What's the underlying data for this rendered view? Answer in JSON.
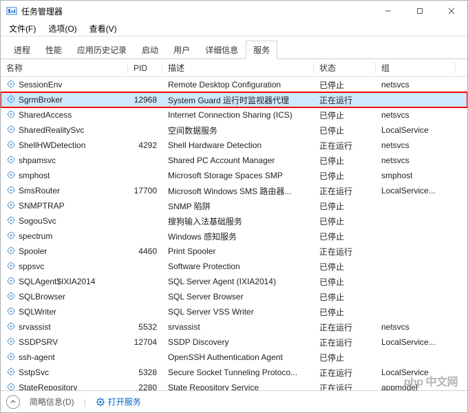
{
  "window": {
    "title": "任务管理器"
  },
  "menu": {
    "file": "文件(F)",
    "options": "选项(O)",
    "view": "查看(V)"
  },
  "tabs": {
    "processes": "进程",
    "performance": "性能",
    "history": "应用历史记录",
    "startup": "启动",
    "users": "用户",
    "details": "详细信息",
    "services": "服务"
  },
  "columns": {
    "name": "名称",
    "pid": "PID",
    "description": "描述",
    "status": "状态",
    "group": "组"
  },
  "services": [
    {
      "name": "SessionEnv",
      "pid": "",
      "desc": "Remote Desktop Configuration",
      "status": "已停止",
      "group": "netsvcs",
      "selected": false
    },
    {
      "name": "SgrmBroker",
      "pid": "12968",
      "desc": "System Guard 运行时监视器代理",
      "status": "正在运行",
      "group": "",
      "selected": true
    },
    {
      "name": "SharedAccess",
      "pid": "",
      "desc": "Internet Connection Sharing (ICS)",
      "status": "已停止",
      "group": "netsvcs",
      "selected": false
    },
    {
      "name": "SharedRealitySvc",
      "pid": "",
      "desc": "空间数据服务",
      "status": "已停止",
      "group": "LocalService",
      "selected": false
    },
    {
      "name": "ShellHWDetection",
      "pid": "4292",
      "desc": "Shell Hardware Detection",
      "status": "正在运行",
      "group": "netsvcs",
      "selected": false
    },
    {
      "name": "shpamsvc",
      "pid": "",
      "desc": "Shared PC Account Manager",
      "status": "已停止",
      "group": "netsvcs",
      "selected": false
    },
    {
      "name": "smphost",
      "pid": "",
      "desc": "Microsoft Storage Spaces SMP",
      "status": "已停止",
      "group": "smphost",
      "selected": false
    },
    {
      "name": "SmsRouter",
      "pid": "17700",
      "desc": "Microsoft Windows SMS 路由器...",
      "status": "正在运行",
      "group": "LocalService...",
      "selected": false
    },
    {
      "name": "SNMPTRAP",
      "pid": "",
      "desc": "SNMP 陷阱",
      "status": "已停止",
      "group": "",
      "selected": false
    },
    {
      "name": "SogouSvc",
      "pid": "",
      "desc": "搜狗输入法基础服务",
      "status": "已停止",
      "group": "",
      "selected": false
    },
    {
      "name": "spectrum",
      "pid": "",
      "desc": "Windows 感知服务",
      "status": "已停止",
      "group": "",
      "selected": false
    },
    {
      "name": "Spooler",
      "pid": "4460",
      "desc": "Print Spooler",
      "status": "正在运行",
      "group": "",
      "selected": false
    },
    {
      "name": "sppsvc",
      "pid": "",
      "desc": "Software Protection",
      "status": "已停止",
      "group": "",
      "selected": false
    },
    {
      "name": "SQLAgent$IXIA2014",
      "pid": "",
      "desc": "SQL Server Agent (IXIA2014)",
      "status": "已停止",
      "group": "",
      "selected": false
    },
    {
      "name": "SQLBrowser",
      "pid": "",
      "desc": "SQL Server Browser",
      "status": "已停止",
      "group": "",
      "selected": false
    },
    {
      "name": "SQLWriter",
      "pid": "",
      "desc": "SQL Server VSS Writer",
      "status": "已停止",
      "group": "",
      "selected": false
    },
    {
      "name": "srvassist",
      "pid": "5532",
      "desc": "srvassist",
      "status": "正在运行",
      "group": "netsvcs",
      "selected": false
    },
    {
      "name": "SSDPSRV",
      "pid": "12704",
      "desc": "SSDP Discovery",
      "status": "正在运行",
      "group": "LocalService...",
      "selected": false
    },
    {
      "name": "ssh-agent",
      "pid": "",
      "desc": "OpenSSH Authentication Agent",
      "status": "已停止",
      "group": "",
      "selected": false
    },
    {
      "name": "SstpSvc",
      "pid": "5328",
      "desc": "Secure Socket Tunneling Protoco...",
      "status": "正在运行",
      "group": "LocalService",
      "selected": false
    },
    {
      "name": "StateRepository",
      "pid": "2280",
      "desc": "State Repository Service",
      "status": "正在运行",
      "group": "appmodel",
      "selected": false
    }
  ],
  "statusbar": {
    "brief": "简略信息(D)",
    "open_services": "打开服务"
  },
  "watermark": "php 中文网"
}
